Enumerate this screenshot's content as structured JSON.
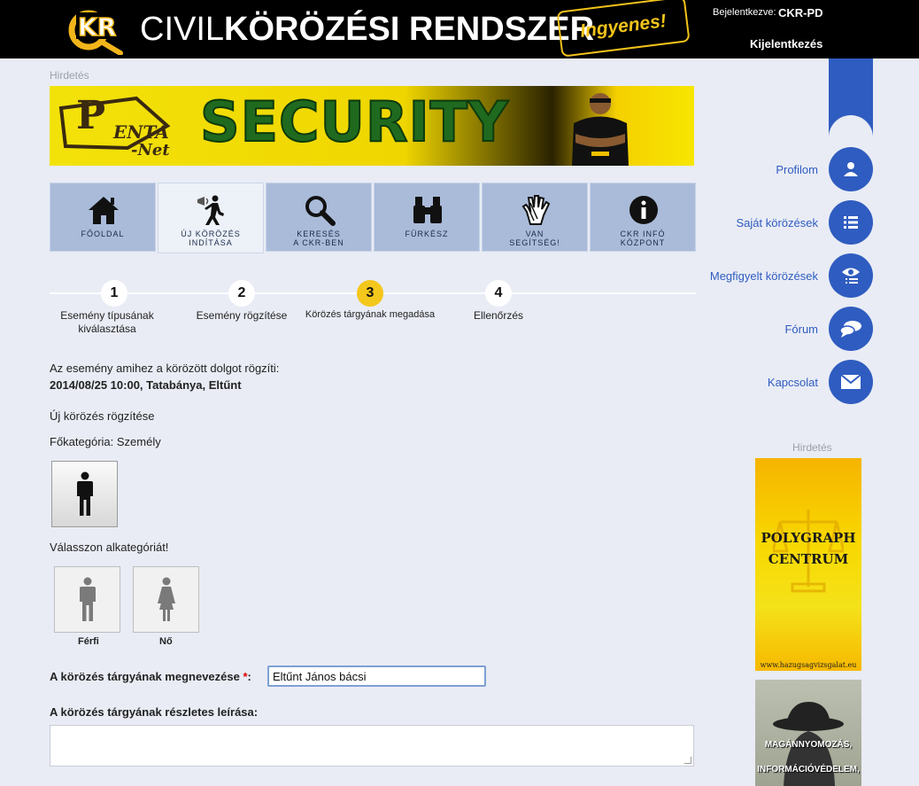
{
  "header": {
    "title_civil": "CIVIL",
    "title_bold": "KÖRÖZÉSI RENDSZER",
    "badge": "Ingyenes!",
    "login_label": "Bejelentkezve:",
    "login_user": "CKR-PD",
    "logout": "Kijelentkezés",
    "logo_text": "KR"
  },
  "ads": {
    "label": "Hirdetés",
    "banner_penta": "P",
    "banner_enta": "ENTA",
    "banner_net": "-Net",
    "banner_security": "SECURITY",
    "poly_text": "POLYGRAPH CENTRUM",
    "poly_url": "www.hazugsagvizsgalat.eu",
    "magan_line1": "MAGÁNNYOMOZÁS,",
    "magan_line2": "INFORMÁCIÓVÉDELEM,"
  },
  "nav": [
    {
      "label": "FŐOLDAL",
      "icon": "house-icon"
    },
    {
      "label": "ÚJ KÖRÖZÉS\nINDÍTÁSA",
      "icon": "megaphone-person-icon",
      "active": true
    },
    {
      "label": "KERESÉS\nA CKR-BEN",
      "icon": "search-icon"
    },
    {
      "label": "FÜRKÉSZ",
      "icon": "binoculars-icon"
    },
    {
      "label": "VAN\nSEGÍTSÉG!",
      "icon": "hand-icon"
    },
    {
      "label": "CKR INFÓ\nKÖZPONT",
      "icon": "info-icon"
    }
  ],
  "sidebar": [
    {
      "label": "Profilom",
      "icon": "user-icon"
    },
    {
      "label": "Saját körözések",
      "icon": "list-icon"
    },
    {
      "label": "Megfigyelt körözések",
      "icon": "eye-list-icon"
    },
    {
      "label": "Fórum",
      "icon": "chat-icon"
    },
    {
      "label": "Kapcsolat",
      "icon": "envelope-icon"
    }
  ],
  "steps": [
    {
      "num": "1",
      "label": "Esemény típusának kiválasztása"
    },
    {
      "num": "2",
      "label": "Esemény rögzítése"
    },
    {
      "num": "3",
      "label": "Körözés tárgyának megadása",
      "current": true
    },
    {
      "num": "4",
      "label": "Ellenőrzés"
    }
  ],
  "form": {
    "event_intro": "Az esemény amihez a körözött dolgot rögzíti:",
    "event_value": "2014/08/25 10:00, Tatabánya, Eltűnt",
    "new_heading": "Új körözés rögzítése",
    "main_category": "Főkategória: Személy",
    "choose_sub": "Válasszon alkategóriát!",
    "sub_male": "Férfi",
    "sub_female": "Nő",
    "name_label": "A körözés tárgyának megnevezése",
    "required_mark": "*",
    "colon": ":",
    "name_value": "Eltűnt János bácsi",
    "desc_label": "A körözés tárgyának részletes leírása:"
  },
  "colors": {
    "accent_blue": "#2f5cc0",
    "step_current": "#f4c71c",
    "nav_bg": "#aabbd9"
  }
}
